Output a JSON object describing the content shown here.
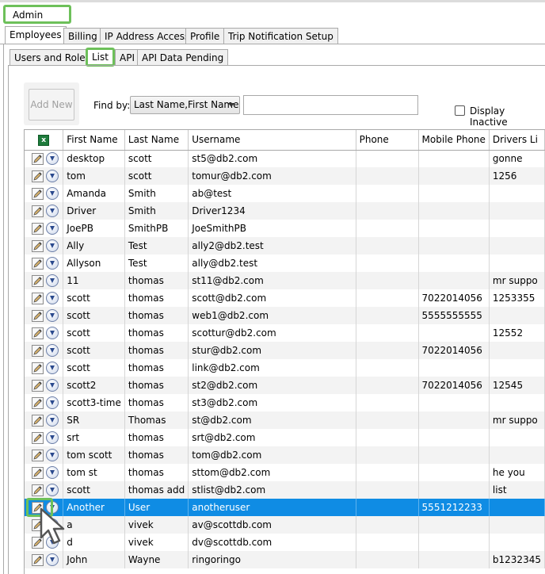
{
  "window": {
    "title": "Admin"
  },
  "top_tabs": [
    "Employees",
    "Billing",
    "IP Address Access",
    "Profile",
    "Trip Notification Setup"
  ],
  "sub_tabs": [
    "Users and Roles",
    "List",
    "API",
    "API Data Pending"
  ],
  "toolbar": {
    "add_new_label": "Add New",
    "find_by_label": "Find by:",
    "find_by_selected": "Last Name,First Name",
    "search_value": "",
    "display_inactive_label": "Display Inactive"
  },
  "table": {
    "excel_icon": "excel-export-icon",
    "columns": [
      "First Name",
      "Last Name",
      "Username",
      "Phone",
      "Mobile Phone",
      "Drivers Li"
    ],
    "rows": [
      {
        "first": "desktop",
        "last": "scott",
        "username": "st5@db2.com",
        "phone": "",
        "mobile": "",
        "license": "gonne"
      },
      {
        "first": "tom",
        "last": "scott",
        "username": "tomur@db2.com",
        "phone": "",
        "mobile": "",
        "license": "1256"
      },
      {
        "first": "Amanda",
        "last": "Smith",
        "username": "ab@test",
        "phone": "",
        "mobile": "",
        "license": ""
      },
      {
        "first": "Driver",
        "last": "Smith",
        "username": "Driver1234",
        "phone": "",
        "mobile": "",
        "license": ""
      },
      {
        "first": "JoePB",
        "last": "SmithPB",
        "username": "JoeSmithPB",
        "phone": "",
        "mobile": "",
        "license": ""
      },
      {
        "first": "Ally",
        "last": "Test",
        "username": "ally2@db2.test",
        "phone": "",
        "mobile": "",
        "license": ""
      },
      {
        "first": "Allyson",
        "last": "Test",
        "username": "ally@db2.test",
        "phone": "",
        "mobile": "",
        "license": ""
      },
      {
        "first": "11",
        "last": "thomas",
        "username": "st11@db2.com",
        "phone": "",
        "mobile": "",
        "license": "mr suppo"
      },
      {
        "first": "scott",
        "last": "thomas",
        "username": "scott@db2.com",
        "phone": "",
        "mobile": "7022014056",
        "license": "1253355"
      },
      {
        "first": "scott",
        "last": "thomas",
        "username": "web1@db2.com",
        "phone": "",
        "mobile": "5555555555",
        "license": ""
      },
      {
        "first": "scott",
        "last": "thomas",
        "username": "scottur@db2.com",
        "phone": "",
        "mobile": "",
        "license": "12552"
      },
      {
        "first": "scott",
        "last": "thomas",
        "username": "stur@db2.com",
        "phone": "",
        "mobile": "7022014056",
        "license": ""
      },
      {
        "first": "scott",
        "last": "thomas",
        "username": "link@db2.com",
        "phone": "",
        "mobile": "",
        "license": ""
      },
      {
        "first": "scott2",
        "last": "thomas",
        "username": "st2@db2.com",
        "phone": "",
        "mobile": "7022014056",
        "license": "12545"
      },
      {
        "first": "scott3-time",
        "last": "thomas",
        "username": "st3@db2.com",
        "phone": "",
        "mobile": "",
        "license": ""
      },
      {
        "first": "SR",
        "last": "Thomas",
        "username": "st@db2.com",
        "phone": "",
        "mobile": "",
        "license": "mr suppo"
      },
      {
        "first": "srt",
        "last": "thomas",
        "username": "srt@db2.com",
        "phone": "",
        "mobile": "",
        "license": ""
      },
      {
        "first": "tom scott",
        "last": "thomas",
        "username": "tom@db2.com",
        "phone": "",
        "mobile": "",
        "license": ""
      },
      {
        "first": "tom st",
        "last": "thomas",
        "username": "sttom@db2.com",
        "phone": "",
        "mobile": "",
        "license": "he you"
      },
      {
        "first": "scott",
        "last": "thomas add",
        "username": "stlist@db2.com",
        "phone": "",
        "mobile": "",
        "license": "list"
      },
      {
        "first": "Another",
        "last": "User",
        "username": "anotheruser",
        "phone": "",
        "mobile": "5551212233",
        "license": ""
      },
      {
        "first": "a",
        "last": "vivek",
        "username": "av@scottdb.com",
        "phone": "",
        "mobile": "",
        "license": ""
      },
      {
        "first": "d",
        "last": "vivek",
        "username": "dv@scottdb.com",
        "phone": "",
        "mobile": "",
        "license": ""
      },
      {
        "first": "John",
        "last": "Wayne",
        "username": "ringoringo",
        "phone": "",
        "mobile": "",
        "license": "b1232345"
      }
    ],
    "selected_row_index": 20,
    "row_icons": [
      "edit-pencil-icon",
      "download-circle-icon"
    ]
  },
  "colors": {
    "highlight": "#6dc05a",
    "selected_row": "#0f8ce4"
  }
}
